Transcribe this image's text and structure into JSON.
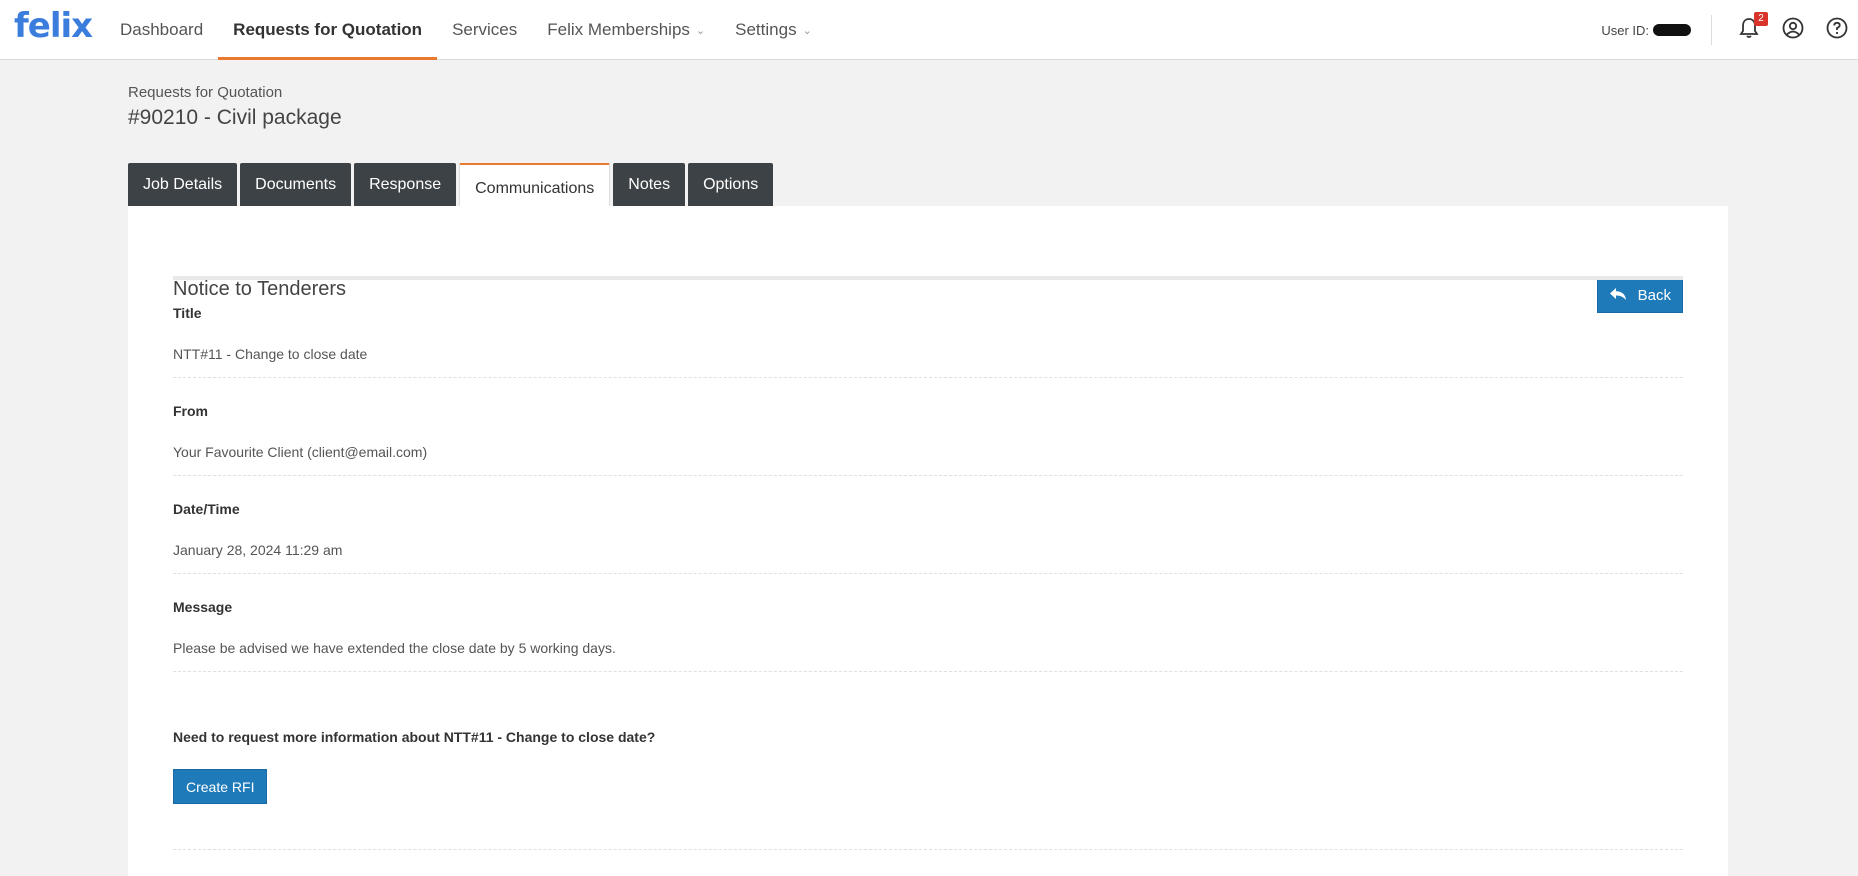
{
  "brand": {
    "logo": "felix",
    "color": "#3b7ddd"
  },
  "nav": {
    "items": [
      {
        "label": "Dashboard"
      },
      {
        "label": "Requests for Quotation"
      },
      {
        "label": "Services"
      },
      {
        "label": "Felix Memberships"
      },
      {
        "label": "Settings"
      }
    ],
    "active": "Requests for Quotation"
  },
  "user": {
    "id_label": "User ID:",
    "notifications_count": "2"
  },
  "page": {
    "breadcrumb": "Requests for Quotation",
    "title": "#90210 - Civil package"
  },
  "tabs": [
    {
      "label": "Job Details"
    },
    {
      "label": "Documents"
    },
    {
      "label": "Response"
    },
    {
      "label": "Communications"
    },
    {
      "label": "Notes"
    },
    {
      "label": "Options"
    }
  ],
  "active_tab": "Communications",
  "notice": {
    "section_title": "Notice to Tenderers",
    "back_label": "Back",
    "fields": [
      {
        "label": "Title",
        "value": "NTT#11 - Change to close date"
      },
      {
        "label": "From",
        "value": "Your Favourite Client (client@email.com)"
      },
      {
        "label": "Date/Time",
        "value": "January 28, 2024 11:29 am"
      },
      {
        "label": "Message",
        "value": "Please be advised we have extended the close date by 5 working days."
      }
    ],
    "rfi_question": "Need to request more information about NTT#11 - Change to close date?",
    "rfi_button": "Create RFI"
  },
  "colors": {
    "accent": "#e8792e",
    "primary_button": "#1f7ab9",
    "tab_dark": "#3d4246",
    "badge": "#d9342b"
  }
}
